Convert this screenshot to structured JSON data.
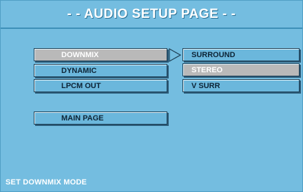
{
  "header": {
    "title": "- - AUDIO SETUP PAGE - -"
  },
  "menu": {
    "items": [
      {
        "label": "DOWNMIX"
      },
      {
        "label": "DYNAMIC"
      },
      {
        "label": "LPCM OUT"
      },
      {
        "label": "MAIN PAGE"
      }
    ]
  },
  "submenu": {
    "options": [
      {
        "label": "SURROUND"
      },
      {
        "label": "STEREO"
      },
      {
        "label": "V SURR"
      }
    ]
  },
  "status": {
    "text": "SET DOWNMIX MODE"
  },
  "colors": {
    "background": "#74bde0",
    "button": "#6bb7dc",
    "selected": "#b9b9b9",
    "text": "#0d2436"
  },
  "icons": {
    "submenu_arrow": "triangle-right-icon"
  }
}
